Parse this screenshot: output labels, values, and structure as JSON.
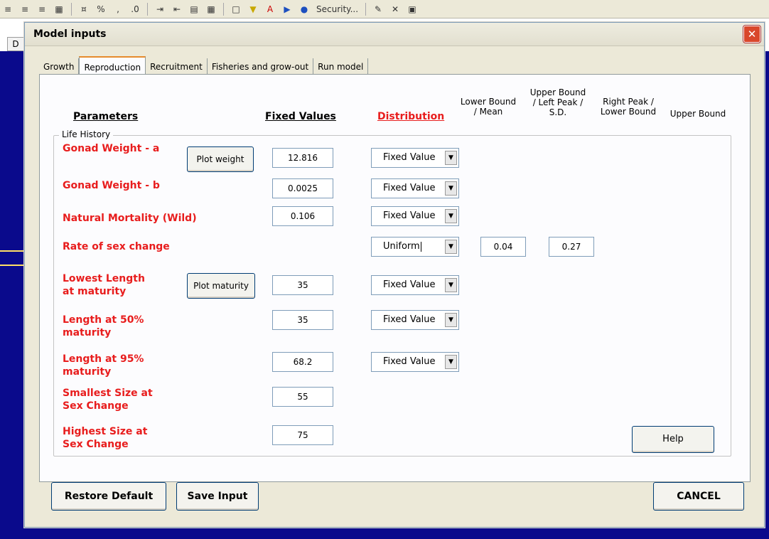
{
  "toolbar": {
    "security_label": "Security..."
  },
  "sheet": {
    "column_d": "D"
  },
  "dialog": {
    "title": "Model inputs",
    "close_glyph": "✕"
  },
  "tabs": [
    {
      "label": "Growth"
    },
    {
      "label": "Reproduction"
    },
    {
      "label": "Recruitment"
    },
    {
      "label": "Fisheries and grow-out"
    },
    {
      "label": "Run model"
    }
  ],
  "headers": {
    "parameters": "Parameters",
    "fixed_values": "Fixed Values",
    "distribution": "Distribution",
    "lower_bound_mean_1": "Lower Bound",
    "lower_bound_mean_2": "/ Mean",
    "upper_bound_left_peak_1": "Upper Bound",
    "upper_bound_left_peak_2": "/ Left Peak /",
    "upper_bound_left_peak_3": "S.D.",
    "right_peak_1": "Right Peak /",
    "right_peak_2": "Lower Bound",
    "upper_bound": "Upper Bound"
  },
  "group": {
    "label": "Life History"
  },
  "params": {
    "gonad_a": {
      "label": "Gonad Weight - a",
      "value": "12.816",
      "distribution": "Fixed Value",
      "button": "Plot weight"
    },
    "gonad_b": {
      "label": "Gonad Weight - b",
      "value": "0.0025",
      "distribution": "Fixed Value"
    },
    "mortality": {
      "label": "Natural Mortality (Wild)",
      "value": "0.106",
      "distribution": "Fixed Value"
    },
    "sex_change": {
      "label": "Rate of sex change",
      "distribution": "Uniform",
      "lower": "0.04",
      "upper": "0.27"
    },
    "lowest_length": {
      "label_1": "Lowest Length",
      "label_2": "at maturity",
      "value": "35",
      "distribution": "Fixed Value",
      "button": "Plot maturity"
    },
    "length50": {
      "label_1": "Length at 50%",
      "label_2": "maturity",
      "value": "35",
      "distribution": "Fixed Value"
    },
    "length95": {
      "label_1": "Length at 95%",
      "label_2": "maturity",
      "value": "68.2",
      "distribution": "Fixed Value"
    },
    "smallest_size": {
      "label_1": "Smallest Size at",
      "label_2": "Sex Change",
      "value": "55"
    },
    "highest_size": {
      "label_1": "Highest Size at",
      "label_2": "Sex Change",
      "value": "75"
    }
  },
  "buttons": {
    "help": "Help",
    "restore_default": "Restore Default",
    "save_input": "Save Input",
    "cancel": "CANCEL"
  },
  "icons": {
    "dropdown": "▼"
  },
  "colors": {
    "param_red": "#e81d1d",
    "sheet_blue": "#0a0a8c"
  }
}
